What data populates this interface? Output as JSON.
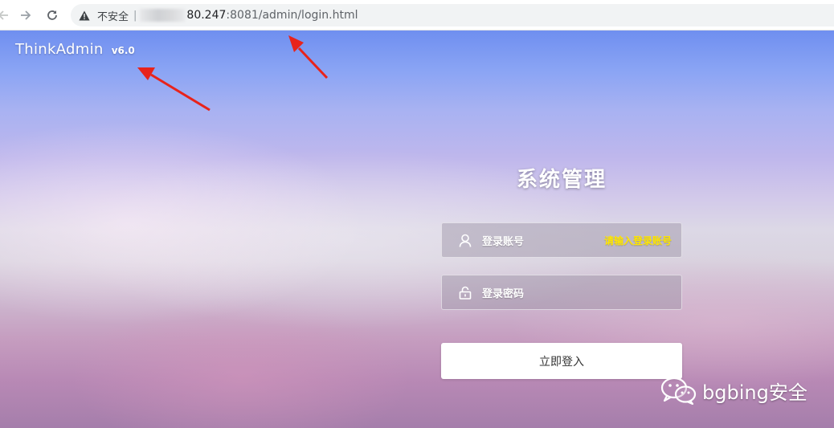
{
  "browser": {
    "security_label": "不安全",
    "url_separator": "|",
    "url_host": "80.247",
    "url_path": ":8081/admin/login.html",
    "icons": [
      "back-arrow-icon",
      "forward-arrow-icon",
      "reload-icon",
      "warning-icon"
    ]
  },
  "brand": {
    "name": "ThinkAdmin",
    "version": "v6.0"
  },
  "login": {
    "title": "系统管理",
    "username": {
      "label": "登录账号",
      "hint": "请输入登录账号",
      "icon": "user-icon"
    },
    "password": {
      "label": "登录密码",
      "icon": "lock-icon"
    },
    "submit_label": "立即登入"
  },
  "watermark": {
    "text": "bgbing安全",
    "icon": "wechat-icon"
  },
  "colors": {
    "hint": "#ffe600",
    "annotation_arrow": "#e8231b",
    "sky_top": "#6f8ff0",
    "sky_bottom": "#a57eab"
  }
}
